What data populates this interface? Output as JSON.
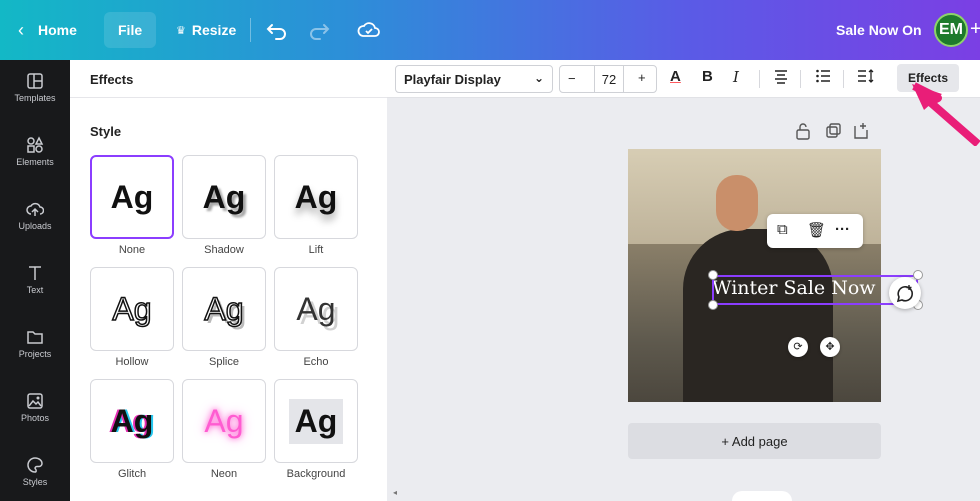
{
  "topbar": {
    "home_label": "Home",
    "file_label": "File",
    "resize_label": "Resize",
    "sale_label": "Sale Now On",
    "avatar_initials": "EM",
    "gradient": [
      "#13b8c6",
      "#7b3fe4"
    ]
  },
  "leftnav": {
    "items": [
      {
        "label": "Templates",
        "icon": "templates-icon"
      },
      {
        "label": "Elements",
        "icon": "elements-icon"
      },
      {
        "label": "Uploads",
        "icon": "upload-cloud-icon"
      },
      {
        "label": "Text",
        "icon": "text-icon"
      },
      {
        "label": "Projects",
        "icon": "folder-icon"
      },
      {
        "label": "Photos",
        "icon": "photo-icon"
      },
      {
        "label": "Styles",
        "icon": "palette-icon"
      }
    ]
  },
  "panel": {
    "title": "Effects",
    "style_heading": "Style",
    "tiles": [
      {
        "label": "None",
        "sample": "Ag",
        "selected": true
      },
      {
        "label": "Shadow",
        "sample": "Ag"
      },
      {
        "label": "Lift",
        "sample": "Ag"
      },
      {
        "label": "Hollow",
        "sample": "Ag"
      },
      {
        "label": "Splice",
        "sample": "Ag"
      },
      {
        "label": "Echo",
        "sample": "Ag"
      },
      {
        "label": "Glitch",
        "sample": "Ag"
      },
      {
        "label": "Neon",
        "sample": "Ag"
      },
      {
        "label": "Background",
        "sample": "Ag"
      }
    ],
    "accent": "#8b3dff"
  },
  "toolbar": {
    "font_name": "Playfair Display",
    "font_size": "72",
    "minus": "−",
    "plus": "+",
    "text_color_glyph": "A",
    "bold_glyph": "B",
    "italic_glyph": "I",
    "effects_label": "Effects"
  },
  "canvas": {
    "text": "Winter Sale Now",
    "add_page_label": "+ Add page",
    "ctx_more": "···"
  }
}
